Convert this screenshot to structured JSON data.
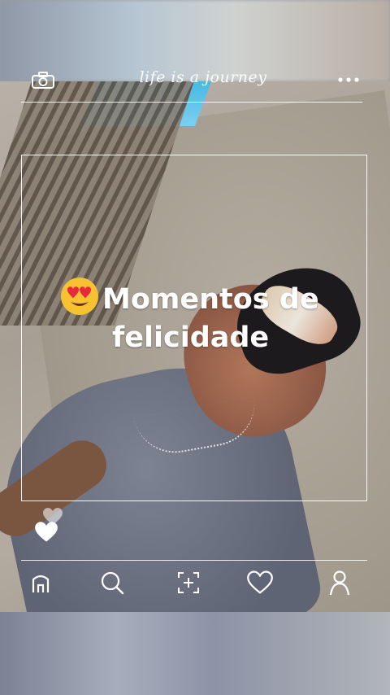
{
  "header": {
    "tagline": "life is a journey",
    "camera_icon": "camera-icon",
    "more_icon": "more-dots-icon"
  },
  "post": {
    "caption_emoji": "heart-eyes-emoji",
    "caption_line1": "Momentos de",
    "caption_line2": "felicidade"
  },
  "reactions": {
    "icons": [
      "heart-outline-icon",
      "heart-filled-icon"
    ]
  },
  "bottom_nav": {
    "items": [
      {
        "name": "home-icon"
      },
      {
        "name": "search-icon"
      },
      {
        "name": "add-post-icon"
      },
      {
        "name": "heart-icon"
      },
      {
        "name": "profile-icon"
      }
    ]
  },
  "colors": {
    "overlay_white": "#ffffff",
    "emoji_face": "#f7c232",
    "emoji_heart": "#e8283c"
  }
}
